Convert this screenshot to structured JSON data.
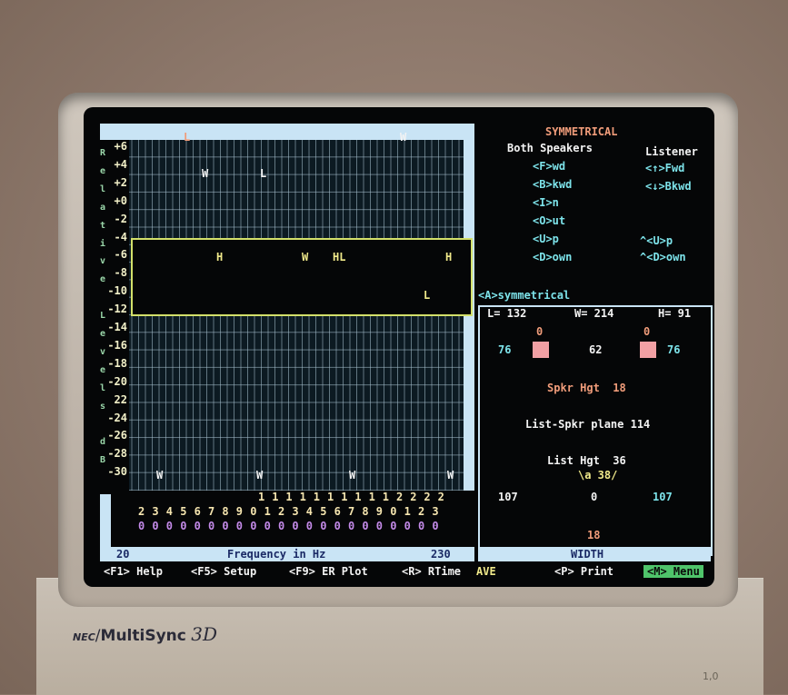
{
  "monitor": {
    "brand_nec": "NEC",
    "brand_model": "MultiSync",
    "brand_suffix": "3D",
    "corner_mark": "1,0"
  },
  "plot": {
    "y_ticks": [
      "+6",
      "+4",
      "+2",
      "+0",
      "-2",
      "-4",
      "-6",
      "-8",
      "-10",
      "-12",
      "-14",
      "-16",
      "-18",
      "-20",
      "22",
      "-24",
      "-26",
      "-28",
      "-30"
    ],
    "side_letters": [
      "R",
      "e",
      "l",
      "a",
      "t",
      "i",
      "v",
      "e",
      "",
      "L",
      "e",
      "v",
      "e",
      "l",
      "s",
      "",
      "d",
      "B"
    ],
    "top_markers": [
      {
        "label": "L",
        "color": "#f09c7a"
      },
      {
        "label": "W",
        "color": "#f3f3f3"
      },
      {
        "label": "W",
        "color": "#f3f3f3"
      },
      {
        "label": "L",
        "color": "#f3f3f3"
      }
    ],
    "overlay_markers": [
      {
        "label": "H",
        "color": "#f0e98a"
      },
      {
        "label": "W",
        "color": "#f0e98a"
      },
      {
        "label": "HL",
        "color": "#f0e98a"
      },
      {
        "label": "H",
        "color": "#f0e98a"
      },
      {
        "label": "L",
        "color": "#f0e98a"
      }
    ],
    "bottom_markers": [
      "W",
      "W",
      "W",
      "W"
    ],
    "freq_digits_row1": [
      "1",
      "1",
      "1",
      "1",
      "1",
      "1",
      "1",
      "1",
      "1",
      "1",
      "2",
      "2",
      "2",
      "2"
    ],
    "freq_digits_row2": [
      "2",
      "3",
      "4",
      "5",
      "6",
      "7",
      "8",
      "9",
      "0",
      "1",
      "2",
      "3",
      "4",
      "5",
      "6",
      "7",
      "8",
      "9",
      "0",
      "1",
      "2",
      "3"
    ],
    "freq_digits_row3": [
      "0",
      "0",
      "0",
      "0",
      "0",
      "0",
      "0",
      "0",
      "0",
      "0",
      "0",
      "0",
      "0",
      "0",
      "0",
      "0",
      "0",
      "0",
      "0",
      "0",
      "0",
      "0"
    ],
    "freq_min": "20",
    "freq_max": "230",
    "freq_caption": "Frequency in Hz"
  },
  "controls": {
    "mode_title": "SYMMETRICAL",
    "both_header": "Both Speakers",
    "listener_header": "Listener",
    "both_items": [
      "<F>wd",
      "<B>kwd",
      "<I>n",
      "<O>ut",
      "<U>p",
      "<D>own"
    ],
    "listener_items": [
      "<↑>Fwd",
      "<↓>Bkwd"
    ],
    "listener_items_lower": [
      "^<U>p",
      "^<D>own"
    ],
    "asym_label": "<A>symmetrical"
  },
  "room": {
    "L": "L= 132",
    "W": "W= 214",
    "H": "H= 91",
    "left_angle": "0",
    "right_angle": "0",
    "left_wall": "76",
    "center_dist": "62",
    "right_wall": "76",
    "spkr_hgt": "Spkr Hgt  18",
    "list_spkr_plane": "List-Spkr plane 114",
    "list_hgt": "List Hgt  36",
    "listen_angle": "\\a 38/",
    "left_back": "107",
    "center_back": "0",
    "right_back": "107",
    "rear": "18",
    "width_caption": "WIDTH"
  },
  "function_keys": {
    "f1": "<F1> Help",
    "f5": "<F5> Setup",
    "f9": "<F9> ER Plot",
    "r": "<R> RTime",
    "ave": "AVE",
    "p": "<P> Print",
    "m": "<M> Menu"
  },
  "colors": {
    "screen_bg": "#050607",
    "grid_frame": "#c9e4f5",
    "overlay_border": "#d3e06a",
    "speaker_marker": "#f2a0a4",
    "menu_highlight": "#4fc46a"
  }
}
